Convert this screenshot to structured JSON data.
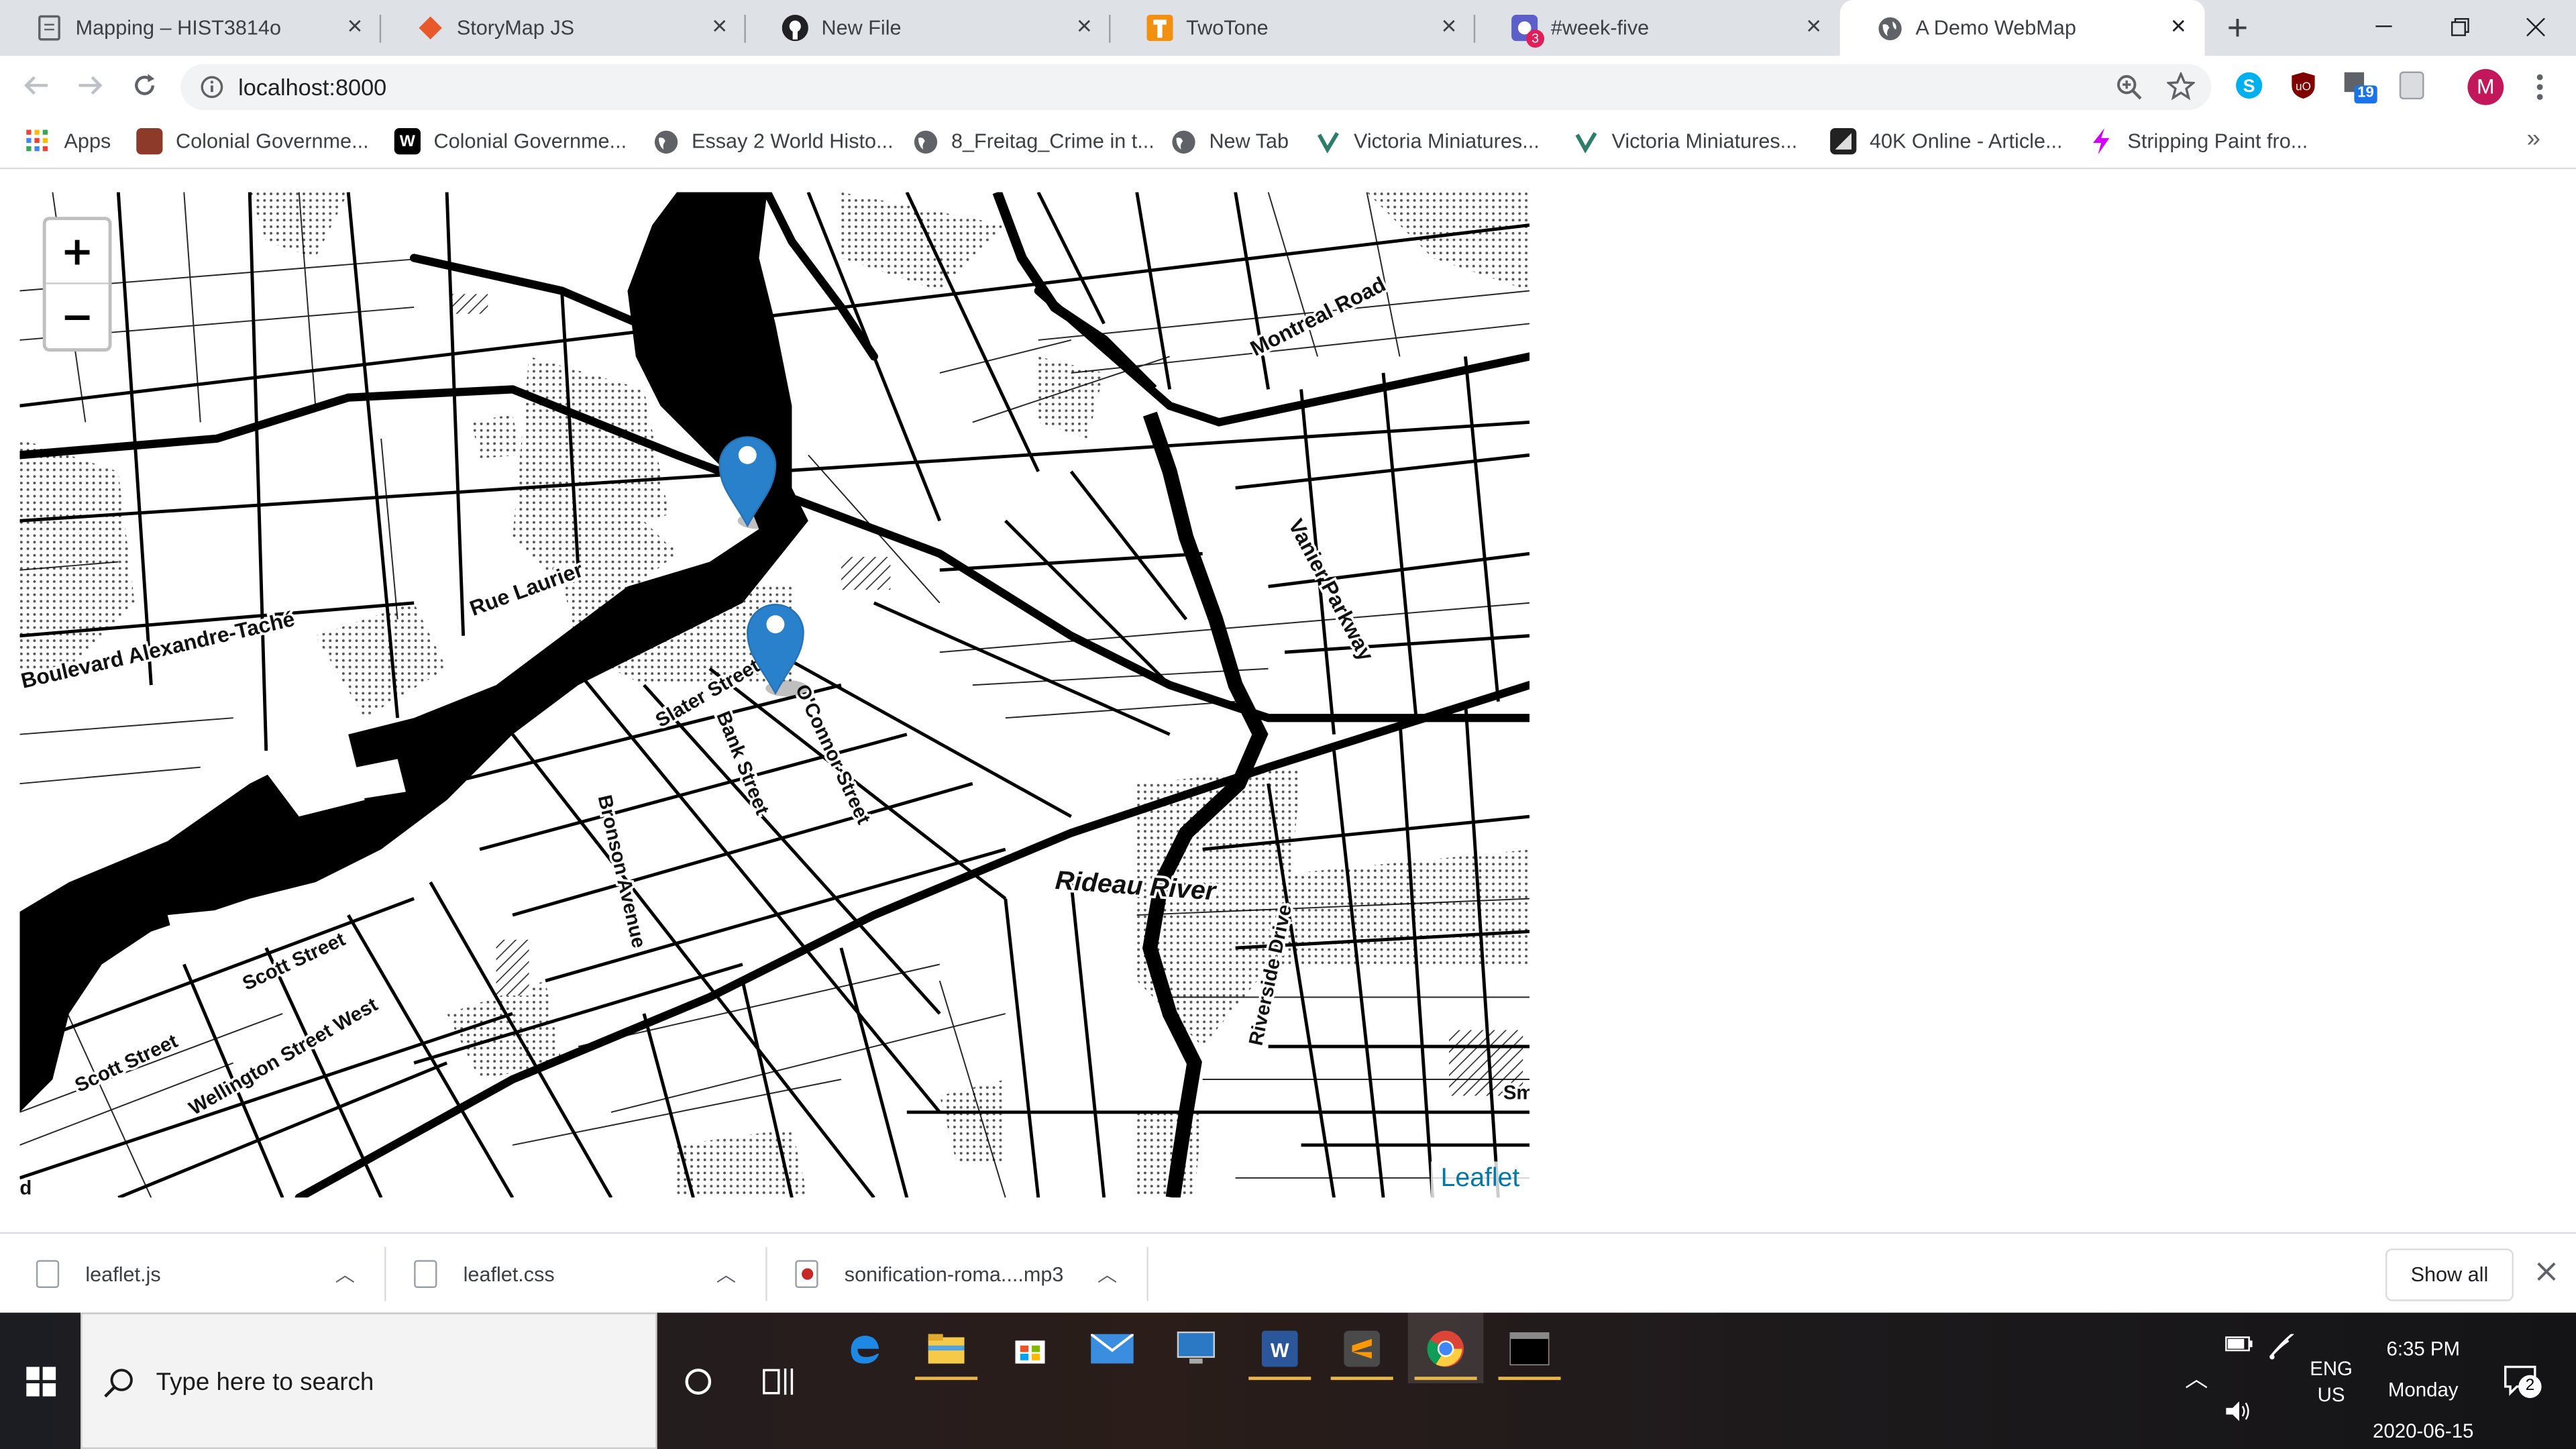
{
  "browser": {
    "tabs": [
      {
        "title": "Mapping – HIST3814o",
        "icon": "document-icon",
        "color": "#4285f4"
      },
      {
        "title": "StoryMap JS",
        "icon": "storymap-icon",
        "color": "#e8582a"
      },
      {
        "title": "New File",
        "icon": "github-icon",
        "color": "#202124"
      },
      {
        "title": "TwoTone",
        "icon": "twotone-icon",
        "color": "#f29111"
      },
      {
        "title": "#week-five",
        "icon": "slack-icon",
        "color": "#4a154b",
        "badge": "3"
      },
      {
        "title": "A Demo WebMap",
        "icon": "globe-icon",
        "color": "#5f6368",
        "active": true
      }
    ],
    "new_tab_symbol": "+",
    "url": "localhost:8000",
    "profile_initial": "M",
    "extension_badge": "19"
  },
  "bookmarks": [
    {
      "label": "Apps",
      "icon": "apps-grid-icon"
    },
    {
      "label": "Colonial Governme...",
      "icon": "bookmark-favicon-icon"
    },
    {
      "label": "Colonial Governme...",
      "icon": "wikipedia-icon"
    },
    {
      "label": "Essay 2 World Histo...",
      "icon": "globe-icon"
    },
    {
      "label": "8_Freitag_Crime in t...",
      "icon": "globe-icon"
    },
    {
      "label": "New Tab",
      "icon": "globe-icon"
    },
    {
      "label": "Victoria Miniatures...",
      "icon": "victoria-icon"
    },
    {
      "label": "Victoria Miniatures...",
      "icon": "victoria-icon"
    },
    {
      "label": "40K Online - Article...",
      "icon": "40k-icon"
    },
    {
      "label": "Stripping Paint fro...",
      "icon": "lightning-icon"
    }
  ],
  "map": {
    "zoom_in": "+",
    "zoom_out": "−",
    "attribution": "Leaflet",
    "labels": {
      "montreal_road": "Montreal Road",
      "vanier_parkway": "Vanier Parkway",
      "rue_laurier": "Rue Laurier",
      "boulevard": "Boulevard Alexandre-Taché",
      "slater": "Slater Street",
      "bank": "Bank Street",
      "oconnor": "O'Connor Street",
      "bronson": "Bronson Avenue",
      "rideau_river": "Rideau River",
      "riverside": "Riverside Drive",
      "scott1": "Scott Street",
      "scott2": "Scott Street",
      "wellington": "Wellington Street West",
      "edge_sm": "Sm",
      "edge_d": "d"
    },
    "marker_color": "#2a81cb"
  },
  "downloads": {
    "items": [
      {
        "name": "leaflet.js"
      },
      {
        "name": "leaflet.css"
      },
      {
        "name": "sonification-roma....mp3"
      }
    ],
    "show_all": "Show all"
  },
  "taskbar": {
    "search_placeholder": "Type here to search",
    "time": "6:35 PM",
    "day": "Monday",
    "date": "2020-06-15",
    "lang": "ENG",
    "region": "US",
    "notification_count": "2"
  }
}
